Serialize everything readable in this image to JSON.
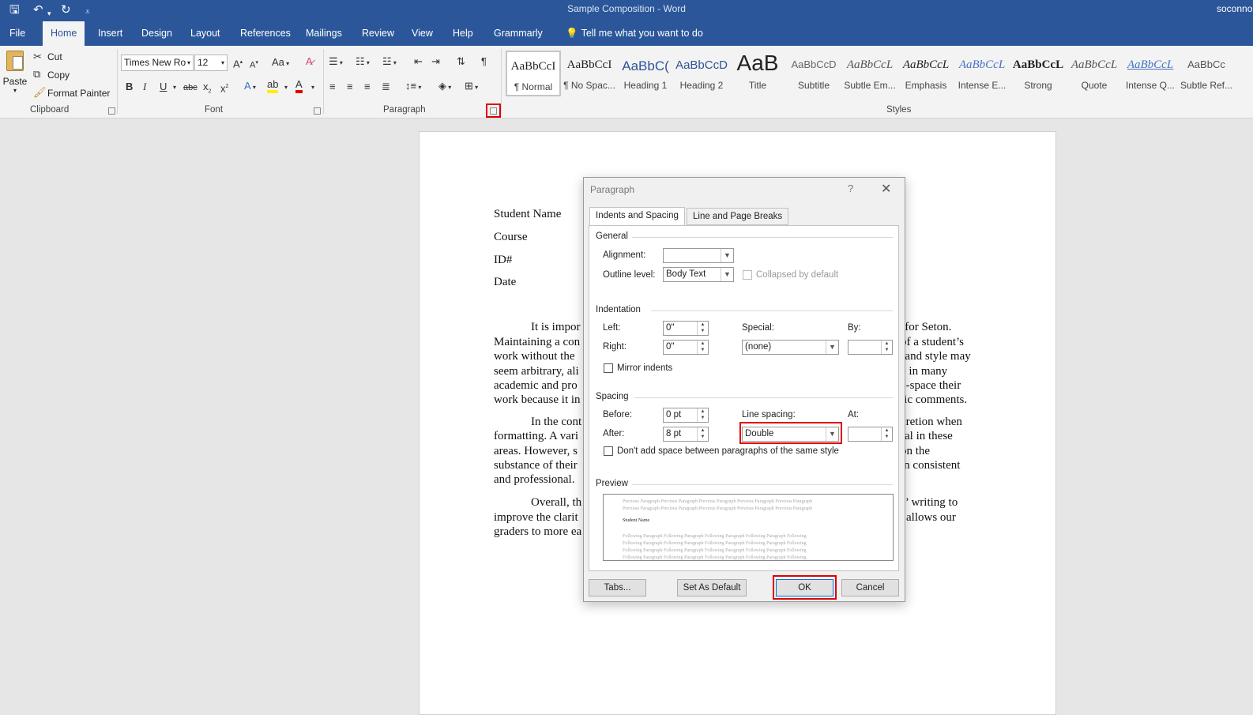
{
  "window": {
    "title": "Sample Composition - Word",
    "user": "soconno"
  },
  "ribbon": {
    "tabs": [
      "File",
      "Home",
      "Insert",
      "Design",
      "Layout",
      "References",
      "Mailings",
      "Review",
      "View",
      "Help",
      "Grammarly"
    ],
    "active_tab": "Home",
    "tell_me": "Tell me what you want to do",
    "clipboard": {
      "paste": "Paste",
      "cut": "Cut",
      "copy": "Copy",
      "format_painter": "Format Painter",
      "label": "Clipboard"
    },
    "font": {
      "family": "Times New Ro",
      "size": "12",
      "change_case": "Aa",
      "label": "Font"
    },
    "paragraph": {
      "label": "Paragraph"
    },
    "styles": {
      "label": "Styles",
      "items": [
        {
          "sample": "AaBbCcI",
          "name": "¶ Normal"
        },
        {
          "sample": "AaBbCcI",
          "name": "¶ No Spac..."
        },
        {
          "sample": "AaBbC(",
          "name": "Heading 1"
        },
        {
          "sample": "AaBbCcD",
          "name": "Heading 2"
        },
        {
          "sample": "AaB",
          "name": "Title"
        },
        {
          "sample": "AaBbCcD",
          "name": "Subtitle"
        },
        {
          "sample": "AaBbCcL",
          "name": "Subtle Em..."
        },
        {
          "sample": "AaBbCcL",
          "name": "Emphasis"
        },
        {
          "sample": "AaBbCcL",
          "name": "Intense E..."
        },
        {
          "sample": "AaBbCcL",
          "name": "Strong"
        },
        {
          "sample": "AaBbCcL",
          "name": "Quote"
        },
        {
          "sample": "AaBbCcL",
          "name": "Intense Q..."
        },
        {
          "sample": "AaBbCc",
          "name": "Subtle Ref..."
        }
      ]
    }
  },
  "document": {
    "header_lines": [
      "Student Name",
      "Course",
      "ID#",
      "Date"
    ],
    "body_left": [
      "It is impor",
      "Maintaining a con",
      "work without the",
      "seem arbitrary, ali",
      "academic and pro",
      "work because it in",
      "In the cont",
      "formatting. A vari",
      "areas. However, s",
      "substance of their",
      "and professional.",
      "Overall, th",
      "improve the clarit",
      "graders to more ea"
    ],
    "body_right": [
      "rk for Seton.",
      "of a student’s",
      "e and style may",
      "e in many",
      "e-space their",
      "ific comments.",
      "cretion when",
      "ral in these",
      "on the",
      "in consistent",
      "s’ writing to",
      "allows our"
    ]
  },
  "dialog": {
    "title": "Paragraph",
    "help": "?",
    "tabs": [
      "Indents and Spacing",
      "Line and Page Breaks"
    ],
    "general": {
      "heading": "General",
      "alignment_label": "Alignment:",
      "alignment_value": "",
      "outline_label": "Outline level:",
      "outline_value": "Body Text",
      "collapsed_label": "Collapsed by default"
    },
    "indentation": {
      "heading": "Indentation",
      "left_label": "Left:",
      "left_value": "0\"",
      "right_label": "Right:",
      "right_value": "0\"",
      "special_label": "Special:",
      "special_value": "(none)",
      "by_label": "By:",
      "by_value": "",
      "mirror_label": "Mirror indents"
    },
    "spacing": {
      "heading": "Spacing",
      "before_label": "Before:",
      "before_value": "0 pt",
      "after_label": "After:",
      "after_value": "8 pt",
      "line_spacing_label": "Line spacing:",
      "line_spacing_value": "Double",
      "at_label": "At:",
      "at_value": "",
      "dont_add_label": "Don't add space between paragraphs of the same style"
    },
    "preview": {
      "heading": "Preview",
      "previous_text": "Previous Paragraph Previous Paragraph Previous Paragraph Previous Paragraph Previous Paragraph",
      "sample_text": "Student Name",
      "following_text": "Following Paragraph Following Paragraph Following Paragraph Following Paragraph Following"
    },
    "buttons": {
      "tabs": "Tabs...",
      "set_default": "Set As Default",
      "ok": "OK",
      "cancel": "Cancel"
    }
  },
  "colors": {
    "brand": "#2b579a",
    "highlight": "#e00000"
  }
}
